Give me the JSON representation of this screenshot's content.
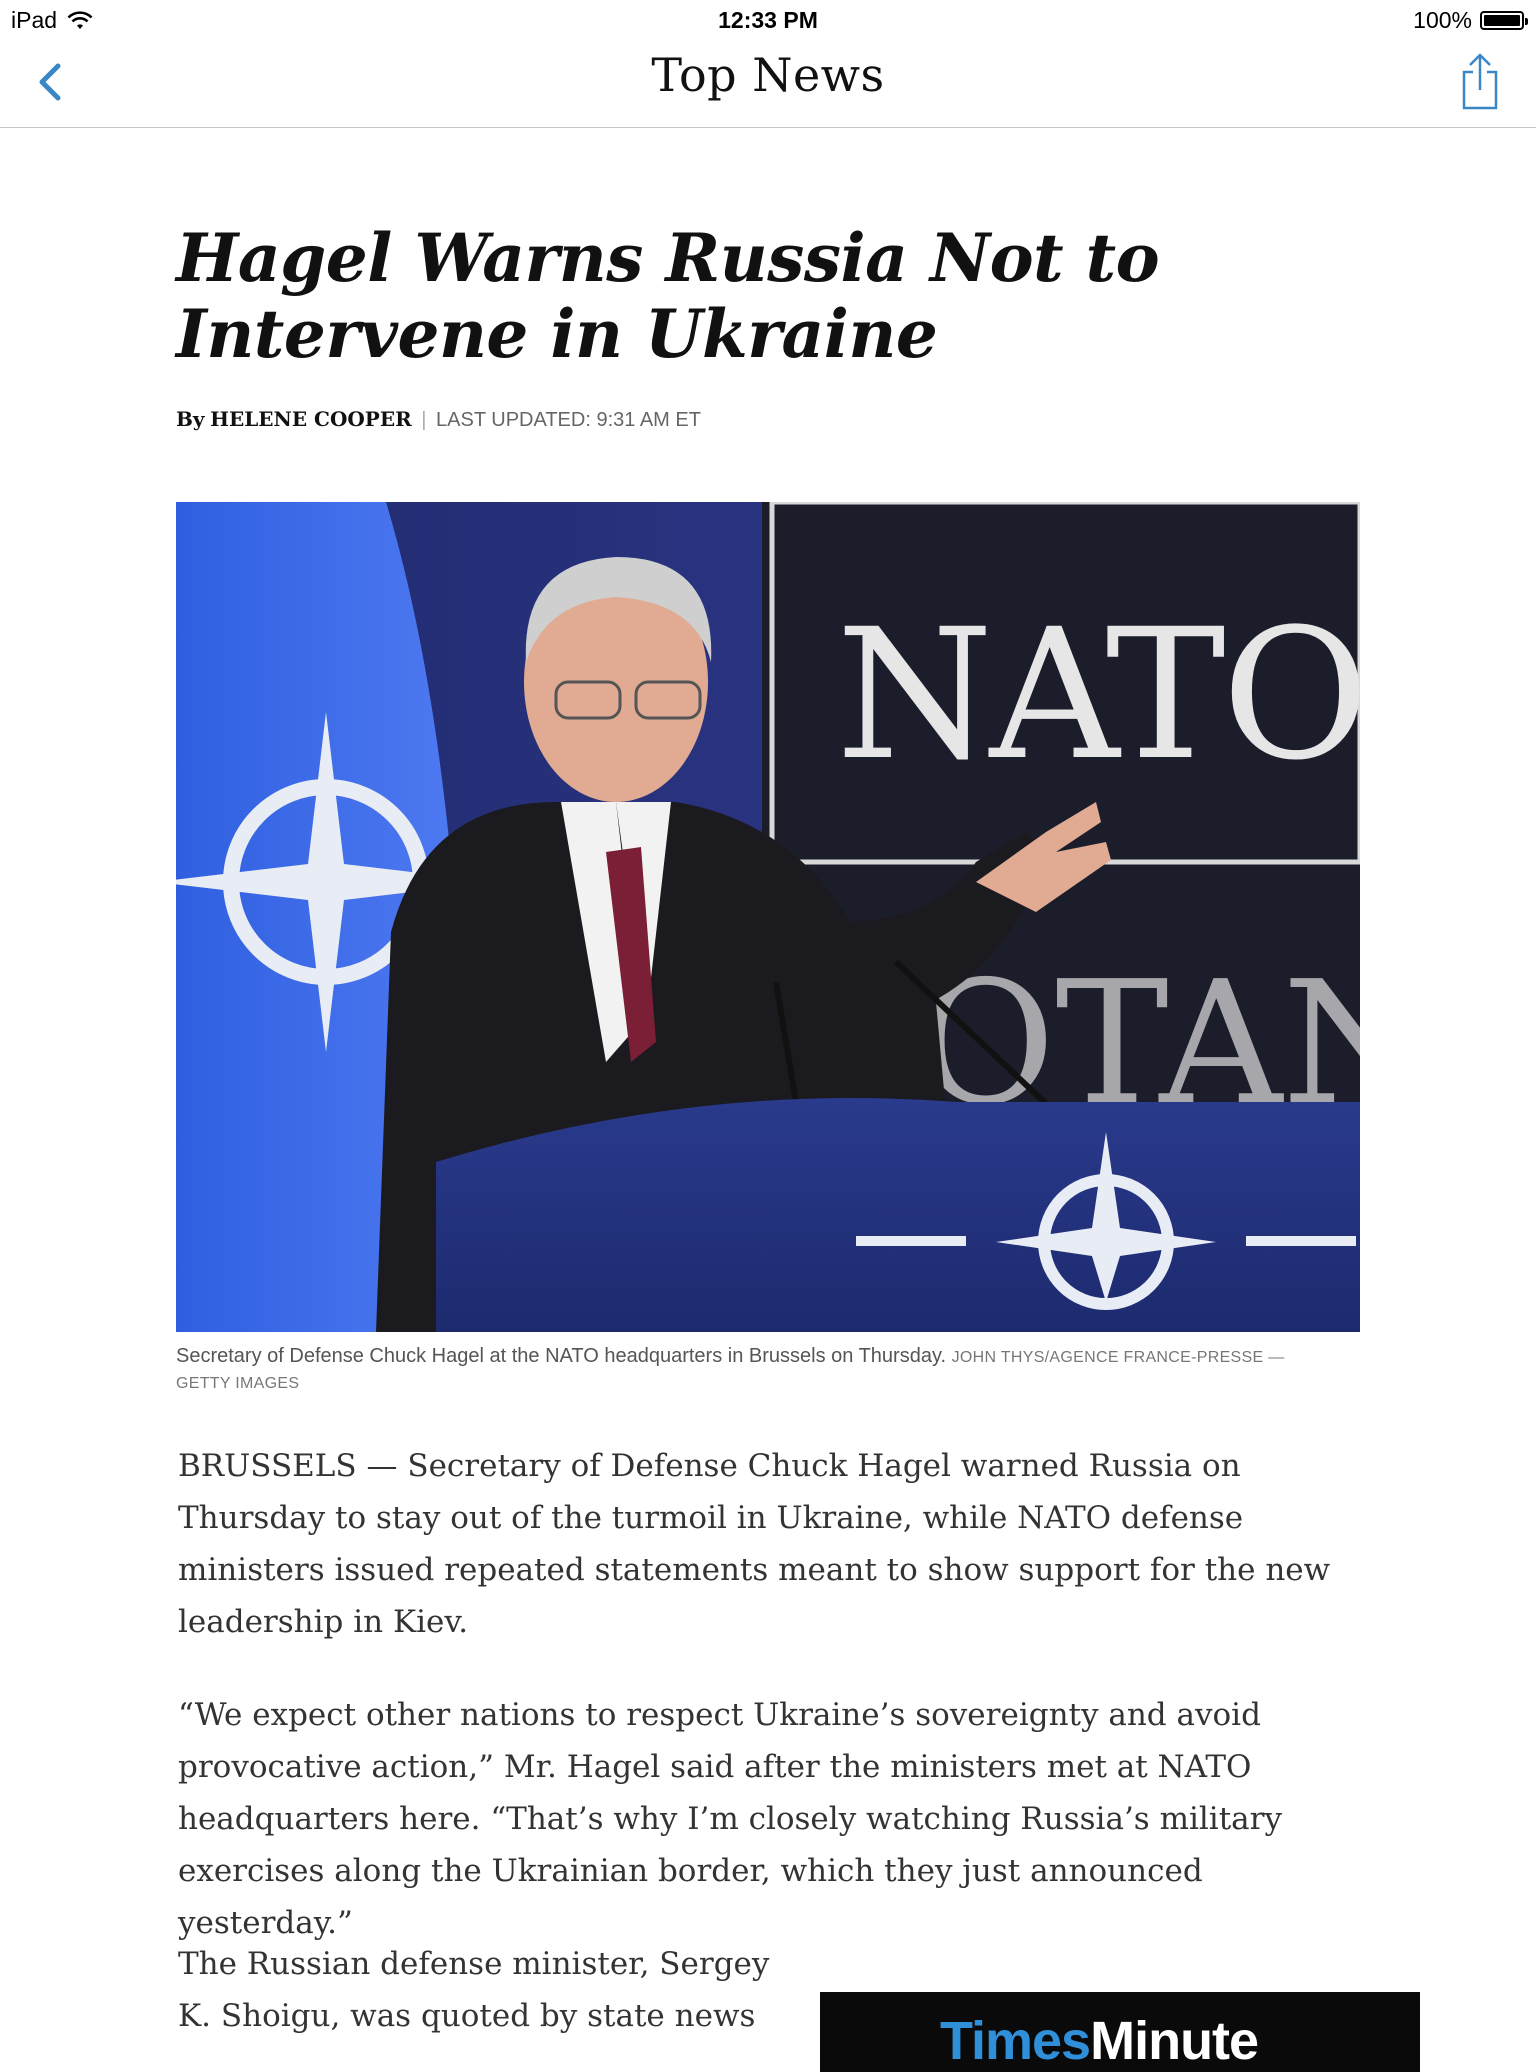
{
  "status_bar": {
    "device": "iPad",
    "time": "12:33 PM",
    "battery": "100%",
    "battery_level": 1.0
  },
  "nav": {
    "title": "Top News",
    "back_icon": "chevron-left-icon",
    "share_icon": "share-icon"
  },
  "article": {
    "headline": "Hagel Warns Russia Not to Intervene in Ukraine",
    "byline_prefix": "By",
    "author": "HELENE COOPER",
    "updated": "LAST UPDATED: 9:31 AM ET",
    "photo_alt": "Secretary of Defense Chuck Hagel at a podium in front of a NATO flag and sign",
    "photo_sign_text": "NATO",
    "photo_sign_text_2": "OTAN",
    "caption": "Secretary of Defense Chuck Hagel at the NATO headquarters in Brussels on Thursday.",
    "credit": "JOHN THYS/AGENCE FRANCE-PRESSE — GETTY IMAGES",
    "paragraphs": [
      "BRUSSELS — Secretary of Defense Chuck Hagel warned Russia on Thursday to stay out of the turmoil in Ukraine, while NATO defense ministers issued repeated statements meant to show support for the new leadership in Kiev.",
      "“We expect other nations to respect Ukraine’s sovereignty and avoid provocative action,” Mr. Hagel said after the ministers met at NATO headquarters here. “That’s why I’m closely watching Russia’s military exercises along the Ukrainian border, which they just announced yesterday.”",
      "The Russian defense minister, Sergey K. Shoigu, was quoted by state news"
    ]
  },
  "promo": {
    "logo_part1": "Times",
    "logo_part2": "Minute"
  },
  "colors": {
    "accent": "#3a87c8",
    "text": "#222222",
    "divider": "#c8c8c8"
  }
}
